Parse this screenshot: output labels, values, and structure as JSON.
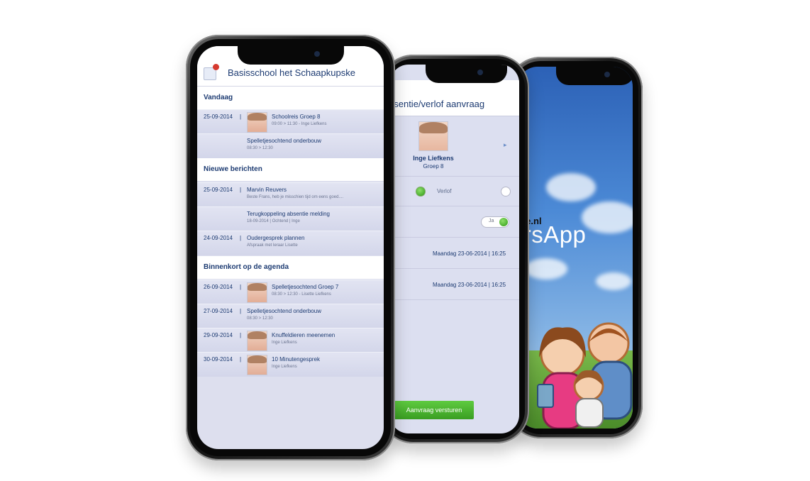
{
  "phone1": {
    "header_title": "Basisschool het Schaapkupske",
    "sections": [
      {
        "title": "Vandaag"
      },
      {
        "title": "Nieuwe berichten"
      },
      {
        "title": "Binnenkort op de agenda"
      }
    ],
    "items": [
      {
        "date": "25-09-2014",
        "sep": "|",
        "title": "Schoolreis Groep 8",
        "sub": "09:00 > 11:30 - Inge Liefkens"
      },
      {
        "date": "",
        "sep": "",
        "title": "Spelletjesochtend onderbouw",
        "sub": "08:30 > 12:30"
      },
      {
        "date": "25-09-2014",
        "sep": "|",
        "title": "Marvin Reuvers",
        "sub": "Beste Frans, heb je misschien tijd om eens goed...."
      },
      {
        "date": "",
        "sep": "",
        "title": "Terugkoppeling absentie melding",
        "sub": "18-09-2014 | Ochtend | Inge"
      },
      {
        "date": "24-09-2014",
        "sep": "|",
        "title": "Oudergesprek plannen",
        "sub": "Afspraak met leraar Lisette"
      },
      {
        "date": "26-09-2014",
        "sep": "|",
        "title": "Spelletjesochtend Groep 7",
        "sub": "08:30 > 12:30 - Lisette Liefkens"
      },
      {
        "date": "27-09-2014",
        "sep": "|",
        "title": "Spelletjesochtend onderbouw",
        "sub": "08:30 > 12:30"
      },
      {
        "date": "29-09-2014",
        "sep": "|",
        "title": "Knuffeldieren meenemen",
        "sub": "Inge Liefkens"
      },
      {
        "date": "30-09-2014",
        "sep": "|",
        "title": "10 Minutengesprek",
        "sub": "Inge Liefkens"
      }
    ]
  },
  "phone2": {
    "title": "bsentie/verlof aanvraag",
    "student_name": "Inge Liefkens",
    "student_group": "Groep 8",
    "arrow": "▸",
    "verlof_label": "Verlof",
    "toggle_label": "Ja",
    "colon": ":",
    "date1": "Maandag 23-06-2014   |   16:25",
    "date2": "Maandag 23-06-2014   |   16:25",
    "submit_label": "Aanvraag versturen"
  },
  "phone3": {
    "url_fragment": "line.nl",
    "app_name": "dersApp"
  },
  "colors": {
    "primary_text": "#1d3b72",
    "submit_green": "#4cb52f",
    "badge_red": "#d63a2f"
  }
}
